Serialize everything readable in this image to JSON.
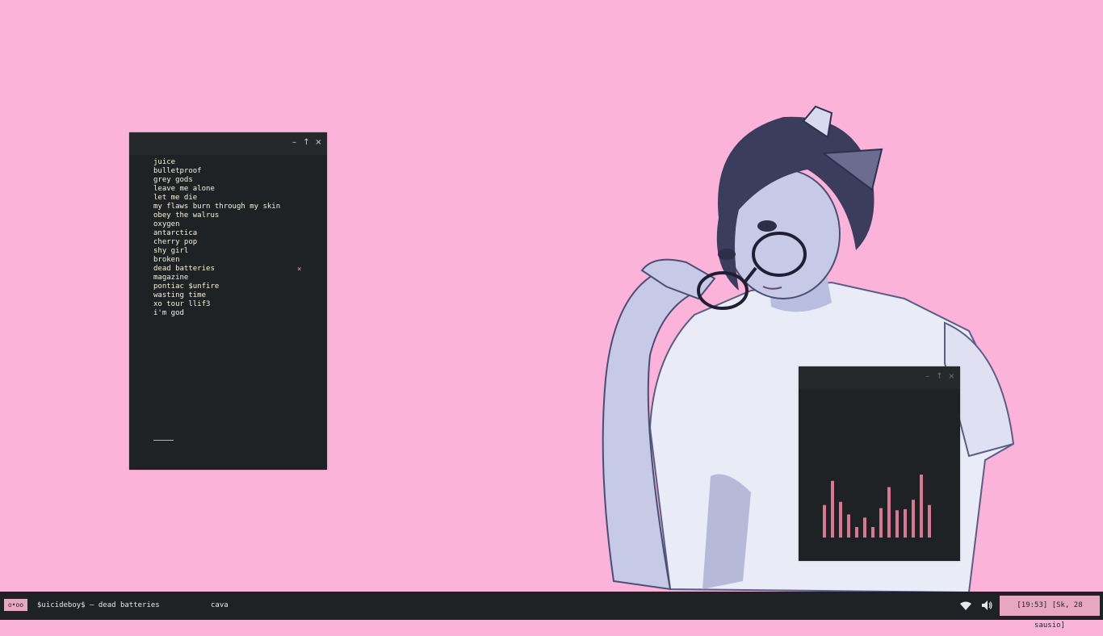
{
  "windows": {
    "playlist": {
      "controls": {
        "minimize": "–",
        "maximize": "↑",
        "close": "×"
      },
      "tracks": [
        "juice",
        "bulletproof",
        "grey gods",
        "leave me alone",
        "let me die",
        "my flaws burn through my skin",
        "obey the walrus",
        "oxygen",
        "antarctica",
        "cherry pop",
        "shy girl",
        "broken",
        "dead batteries",
        "magazine",
        "pontiac $unfire",
        "wasting time",
        "xo tour llif3",
        "i'm god"
      ],
      "now_playing_marker": "×",
      "now_playing_index": 12
    },
    "cava": {
      "controls": {
        "minimize": "–",
        "maximize": "↑",
        "close": "×"
      },
      "bars": [
        0.31,
        0.54,
        0.34,
        0.22,
        0.1,
        0.19,
        0.1,
        0.28,
        0.48,
        0.26,
        0.27,
        0.36,
        0.6,
        0.31
      ]
    }
  },
  "taskbar": {
    "workspace": "o•oo",
    "active_title": "$uicideboy$ – dead batteries",
    "task_cava": "cava",
    "wifi_icon": "wifi-icon",
    "volume_icon": "volume-icon",
    "clock": "[19:53] [Sk, 28 sausio]"
  },
  "colors": {
    "desktop": "#fcb3d9",
    "window_bg": "#1f2224",
    "accent": "#e8a7c0",
    "bar": "#d9788f",
    "text": "#f6f2dc"
  }
}
